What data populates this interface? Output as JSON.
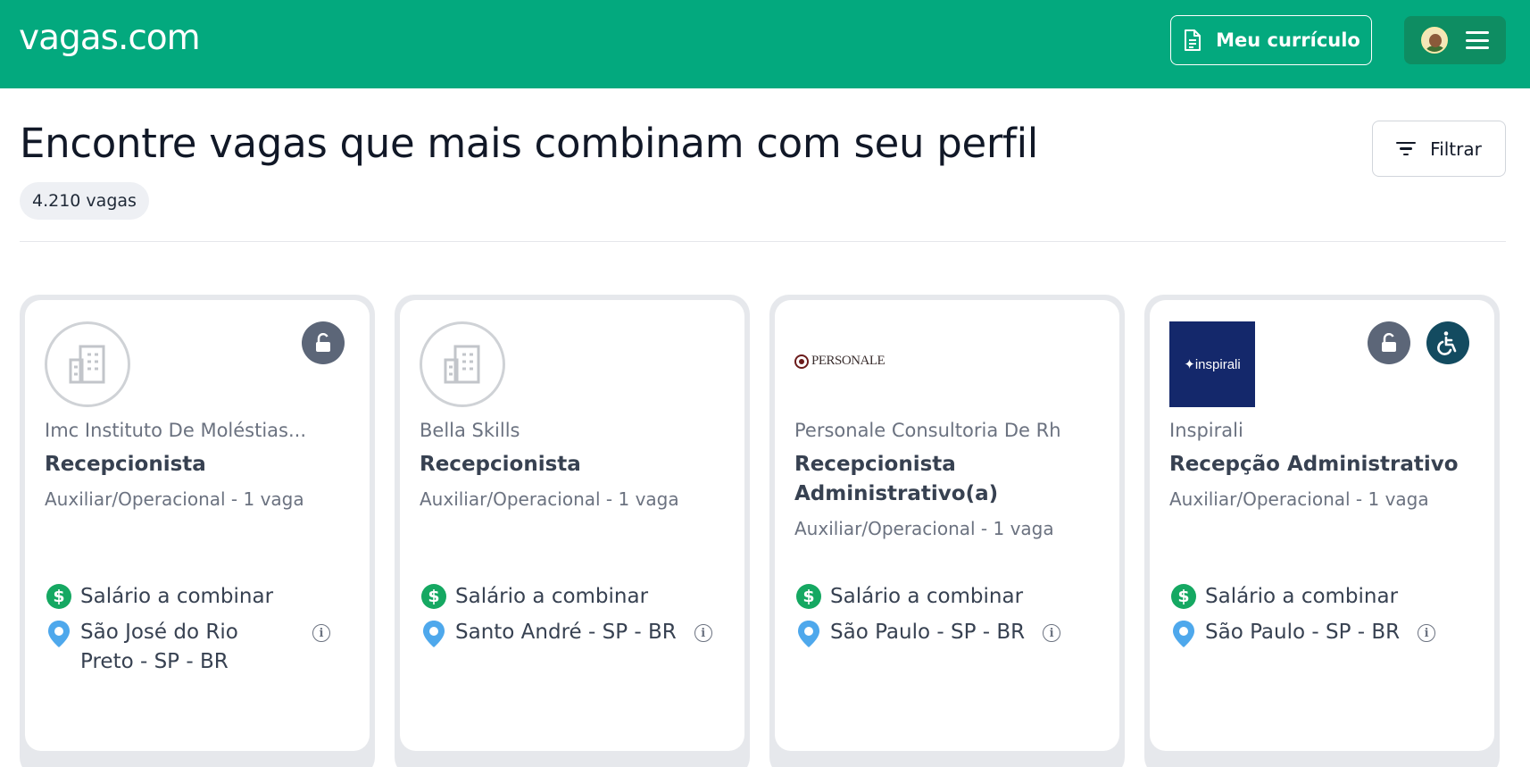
{
  "header": {
    "logo_text": "vagas.com",
    "cv_button_label": "Meu currículo",
    "brand_color": "#03a97e"
  },
  "main": {
    "title": "Encontre vagas que mais combinam com seu perfil",
    "job_count": "4.210 vagas",
    "filter_label": "Filtrar"
  },
  "jobs": [
    {
      "company": "Imc Instituto De Moléstias...",
      "title": "Recepcionista",
      "meta": "Auxiliar/Operacional - 1 vaga",
      "salary": "Salário a combinar",
      "location": "São José do Rio Preto - SP - BR",
      "logo": "building-icon",
      "badges": [
        "lock-icon"
      ]
    },
    {
      "company": "Bella Skills",
      "title": "Recepcionista",
      "meta": "Auxiliar/Operacional - 1 vaga",
      "salary": "Salário a combinar",
      "location": "Santo André - SP - BR",
      "logo": "building-icon",
      "badges": []
    },
    {
      "company": "Personale Consultoria De Rh",
      "title": "Recepcionista Administrativo(a)",
      "meta": "Auxiliar/Operacional - 1 vaga",
      "salary": "Salário a combinar",
      "location": "São Paulo - SP - BR",
      "logo_text": "PERSONALE",
      "badges": []
    },
    {
      "company": "Inspirali",
      "title": "Recepção Administrativo",
      "meta": "Auxiliar/Operacional - 1 vaga",
      "salary": "Salário a combinar",
      "location": "São Paulo - SP - BR",
      "logo_text": "✦inspirali",
      "badges": [
        "lock-icon",
        "accessibility-icon"
      ]
    }
  ]
}
